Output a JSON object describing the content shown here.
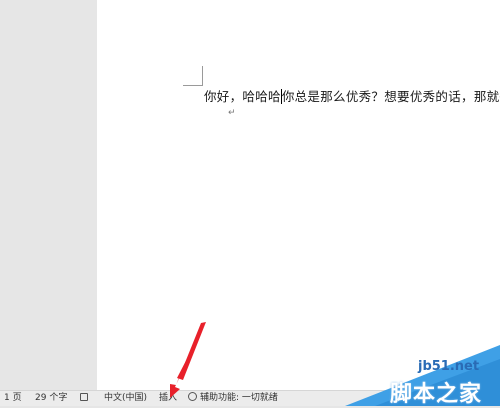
{
  "document": {
    "text_before_cursor": "你好，哈哈哈",
    "text_after_cursor": "你总是那么优秀？想要优秀的话，那就得",
    "paragraph_mark": "↵"
  },
  "statusbar": {
    "page": "1 页",
    "word_count": "29 个字",
    "language": "中文(中国)",
    "mode": "插入",
    "accessibility": "辅助功能: 一切就绪"
  },
  "watermark": {
    "url": "jb51.net",
    "name": "脚本之家"
  },
  "colors": {
    "arrow": "#e8202a",
    "watermark_blue": "#3fa0e6",
    "url_blue": "#2a6bb5"
  }
}
